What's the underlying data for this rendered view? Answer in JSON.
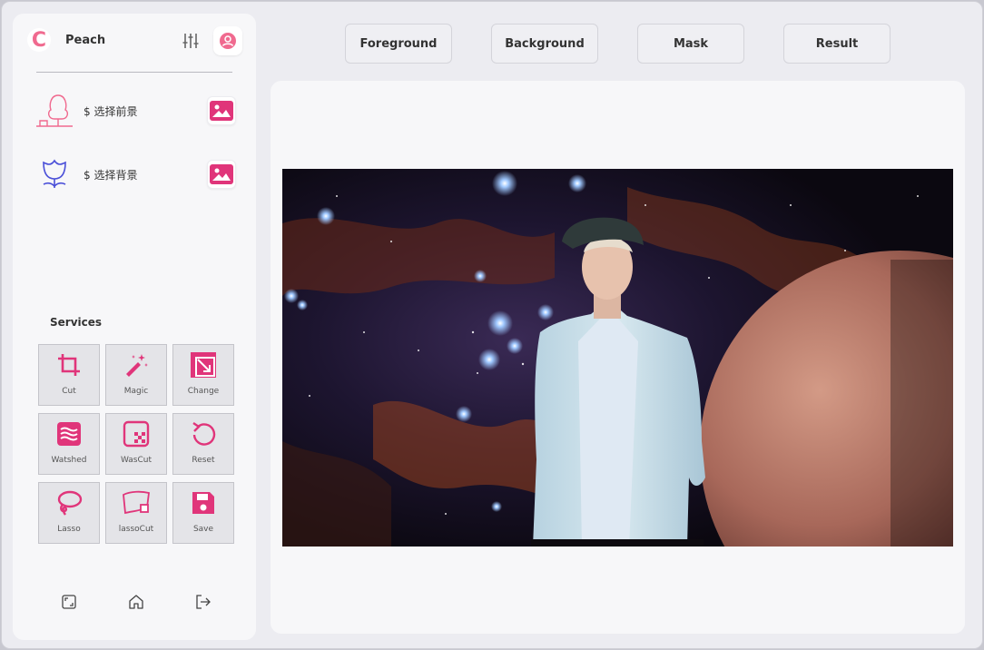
{
  "app": {
    "name": "Peach"
  },
  "sidebar": {
    "select_foreground_label": "$ 选择前景",
    "select_background_label": "$ 选择背景",
    "services_title": "Services",
    "services": [
      {
        "label": "Cut",
        "icon": "crop-icon"
      },
      {
        "label": "Magic",
        "icon": "magic-wand-icon"
      },
      {
        "label": "Change",
        "icon": "resize-icon"
      },
      {
        "label": "Watshed",
        "icon": "waves-icon"
      },
      {
        "label": "WasCut",
        "icon": "dashed-crop-icon"
      },
      {
        "label": "Reset",
        "icon": "reset-icon"
      },
      {
        "label": "Lasso",
        "icon": "lasso-icon"
      },
      {
        "label": "lassoCut",
        "icon": "lasso-cut-icon"
      },
      {
        "label": "Save",
        "icon": "save-icon"
      }
    ],
    "bottom_nav": [
      "fullscreen-icon",
      "home-icon",
      "logout-icon"
    ]
  },
  "tabs": [
    "Foreground",
    "Background",
    "Mask",
    "Result"
  ],
  "colors": {
    "accent": "#e0357a",
    "fg_icon": "#f06a8f",
    "bg_icon": "#4a4fd8",
    "text": "#333333"
  }
}
